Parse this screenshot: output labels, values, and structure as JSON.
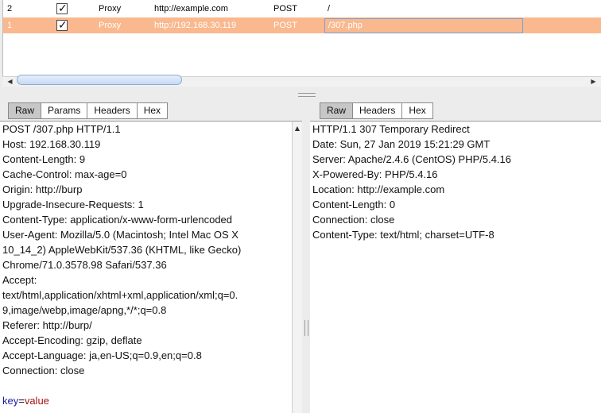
{
  "history": {
    "rows": [
      {
        "num": "2",
        "tool": "Proxy",
        "host": "http://example.com",
        "method": "POST",
        "url": "/"
      },
      {
        "num": "1",
        "tool": "Proxy",
        "host": "http://192.168.30.119",
        "method": "POST",
        "url": "/307.php"
      }
    ],
    "highlight_color": "#f9b88e"
  },
  "request_pane": {
    "tabs": [
      "Raw",
      "Params",
      "Headers",
      "Hex"
    ],
    "active_tab": "Raw",
    "lines": [
      "POST /307.php HTTP/1.1",
      "Host: 192.168.30.119",
      "Content-Length: 9",
      "Cache-Control: max-age=0",
      "Origin: http://burp",
      "Upgrade-Insecure-Requests: 1",
      "Content-Type: application/x-www-form-urlencoded",
      "User-Agent: Mozilla/5.0 (Macintosh; Intel Mac OS X",
      "10_14_2) AppleWebKit/537.36 (KHTML, like Gecko)",
      "Chrome/71.0.3578.98 Safari/537.36",
      "Accept:",
      "text/html,application/xhtml+xml,application/xml;q=0.",
      "9,image/webp,image/apng,*/*;q=0.8",
      "Referer: http://burp/",
      "Accept-Encoding: gzip, deflate",
      "Accept-Language: ja,en-US;q=0.9,en;q=0.8",
      "Connection: close",
      ""
    ],
    "body": {
      "key": "key",
      "eq": "=",
      "value": "value"
    }
  },
  "response_pane": {
    "tabs": [
      "Raw",
      "Headers",
      "Hex"
    ],
    "active_tab": "Raw",
    "lines": [
      "HTTP/1.1 307 Temporary Redirect",
      "Date: Sun, 27 Jan 2019 15:21:29 GMT",
      "Server: Apache/2.4.6 (CentOS) PHP/5.4.16",
      "X-Powered-By: PHP/5.4.16",
      "Location: http://example.com",
      "Content-Length: 0",
      "Connection: close",
      "Content-Type: text/html; charset=UTF-8"
    ]
  },
  "icons": {
    "checkbox": "checkmark-icon",
    "scroll_left": "arrow-left-icon",
    "scroll_right": "arrow-right-icon",
    "scroll_up": "arrow-up-icon"
  }
}
